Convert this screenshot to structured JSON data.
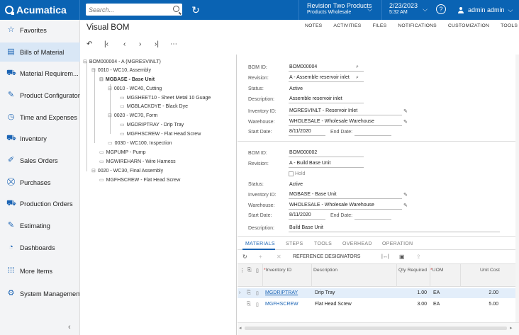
{
  "header": {
    "logo_text": "Acumatica",
    "search_placeholder": "Search...",
    "company": "Revision Two Products",
    "branch": "Products Wholesale",
    "date": "2/23/2023",
    "time": "5:32 AM",
    "user": "admin admin",
    "help_glyph": "?",
    "history_glyph": "↻"
  },
  "sidebar": {
    "items": [
      {
        "label": "Favorites",
        "icon": "star-icon",
        "glyph": "☆"
      },
      {
        "label": "Bills of Material",
        "icon": "document-icon",
        "glyph": "▤"
      },
      {
        "label": "Material Requirem...",
        "icon": "cart-icon",
        "glyph": "⛟"
      },
      {
        "label": "Product Configurator",
        "icon": "wrench-icon",
        "glyph": "✎"
      },
      {
        "label": "Time and Expenses",
        "icon": "clock-icon",
        "glyph": "◷"
      },
      {
        "label": "Inventory",
        "icon": "truck-icon",
        "glyph": "⛟"
      },
      {
        "label": "Sales Orders",
        "icon": "sales-icon",
        "glyph": "✐"
      },
      {
        "label": "Purchases",
        "icon": "shopping-cart-icon",
        "glyph": "⛒"
      },
      {
        "label": "Production Orders",
        "icon": "factory-icon",
        "glyph": "⛟"
      },
      {
        "label": "Estimating",
        "icon": "pencil-icon",
        "glyph": "✎"
      },
      {
        "label": "Dashboards",
        "icon": "dashboard-icon",
        "glyph": "◔"
      },
      {
        "label": "More Items",
        "icon": "grid-icon",
        "glyph": "⁞⁞⁞"
      },
      {
        "label": "System Management",
        "icon": "settings-icon",
        "glyph": "⚙"
      }
    ],
    "collapse_glyph": "‹"
  },
  "page": {
    "title": "Visual BOM",
    "links": [
      "NOTES",
      "ACTIVITIES",
      "FILES",
      "NOTIFICATIONS",
      "CUSTOMIZATION",
      "TOOLS"
    ],
    "nav_glyphs": [
      "↶",
      "|‹",
      "‹",
      "›",
      "›|",
      "⋯"
    ]
  },
  "tree": {
    "nodes": [
      {
        "text": "BOM000004 - A (MGRESVINLT)",
        "bold": false
      },
      {
        "text": "0010 - WC10, Assembly",
        "bold": false
      },
      {
        "text": "MGBASE - Base Unit",
        "bold": true
      },
      {
        "text": "0010 - WC40, Cutting",
        "bold": false
      },
      {
        "text": "MGSHEET10 - Sheet Metal 10 Guage",
        "bold": false
      },
      {
        "text": "MGBLACKDYE - Black Dye",
        "bold": false
      },
      {
        "text": "0020 - WC70, Form",
        "bold": false
      },
      {
        "text": "MGDRIPTRAY - Drip Tray",
        "bold": false
      },
      {
        "text": "MGFHSCREW - Flat Head Screw",
        "bold": false
      },
      {
        "text": "0030 - WC100, Inspection",
        "bold": false
      },
      {
        "text": "MGPUMP - Pump",
        "bold": false
      },
      {
        "text": "MGWIREHARN - Wire Harness",
        "bold": false
      },
      {
        "text": "0020 - WC30, Final Assembly",
        "bold": false
      },
      {
        "text": "MGFHSCREW - Flat Head Screw",
        "bold": false
      }
    ]
  },
  "form1": {
    "bom_id_label": "BOM ID:",
    "bom_id": "BOM000004",
    "revision_label": "Revision:",
    "revision": "A - Assemble reservoir inlet",
    "status_label": "Status:",
    "status": "Active",
    "description_label": "Description:",
    "description": "Assemble reservoir inlet",
    "inventory_id_label": "Inventory ID:",
    "inventory_id": "MGRESVINLT - Reservoir Inlet",
    "warehouse_label": "Warehouse:",
    "warehouse": "WHOLESALE - Wholesale Warehouse",
    "start_date_label": "Start Date:",
    "start_date": "8/11/2020",
    "end_date_label": "End Date:"
  },
  "form2": {
    "bom_id_label": "BOM ID:",
    "bom_id": "BOM000002",
    "revision_label": "Revision:",
    "revision": "A - Build Base Unit",
    "hold_label": "Hold",
    "status_label": "Status:",
    "status": "Active",
    "inventory_id_label": "Inventory ID:",
    "inventory_id": "MGBASE - Base Unit",
    "warehouse_label": "Warehouse:",
    "warehouse": "WHOLESALE - Wholesale Warehouse",
    "start_date_label": "Start Date:",
    "start_date": "8/11/2020",
    "end_date_label": "End Date:",
    "description_label": "Description:",
    "description": "Build Base Unit"
  },
  "tabs": [
    "MATERIALS",
    "STEPS",
    "TOOLS",
    "OVERHEAD",
    "OPERATION"
  ],
  "grid": {
    "toolbar": {
      "refresh": "↻",
      "add": "+",
      "delete": "✕",
      "ref_designators": "REFERENCE DESIGNATORS",
      "fit": "|↔|",
      "excel": "▣",
      "upload": "⇪"
    },
    "columns": {
      "inventory_id": "Inventory ID",
      "description": "Description",
      "qty_required": "Qty Required",
      "uom": "UOM",
      "unit_cost": "Unit Cost"
    },
    "rows": [
      {
        "inventory_id": "MGDRIPTRAY",
        "description": "Drip Tray",
        "qty_required": "1.00",
        "uom": "EA",
        "unit_cost": "2.00"
      },
      {
        "inventory_id": "MGFHSCREW",
        "description": "Flat Head Screw",
        "qty_required": "3.00",
        "uom": "EA",
        "unit_cost": "5.00"
      }
    ]
  }
}
